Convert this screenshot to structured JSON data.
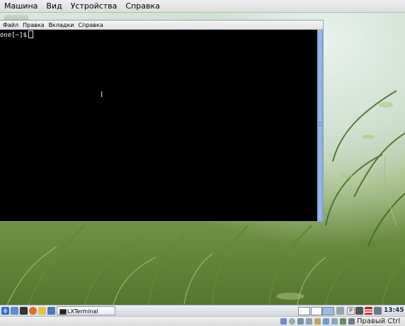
{
  "host_menu": [
    "Машина",
    "Вид",
    "Устройства",
    "Справка"
  ],
  "terminal": {
    "menu": [
      "Файл",
      "Правка",
      "Вкладки",
      "Справка"
    ],
    "prompt": "one[~]$"
  },
  "taskbar": {
    "task_label": "LXTerminal",
    "clock": "13:45"
  },
  "status_bar": {
    "host_key": "Правый Ctrl"
  },
  "colors": {
    "terminal_bg": "#000000",
    "scrollbar": "#8fb2e0",
    "taskbar": "#dfe3ea"
  }
}
